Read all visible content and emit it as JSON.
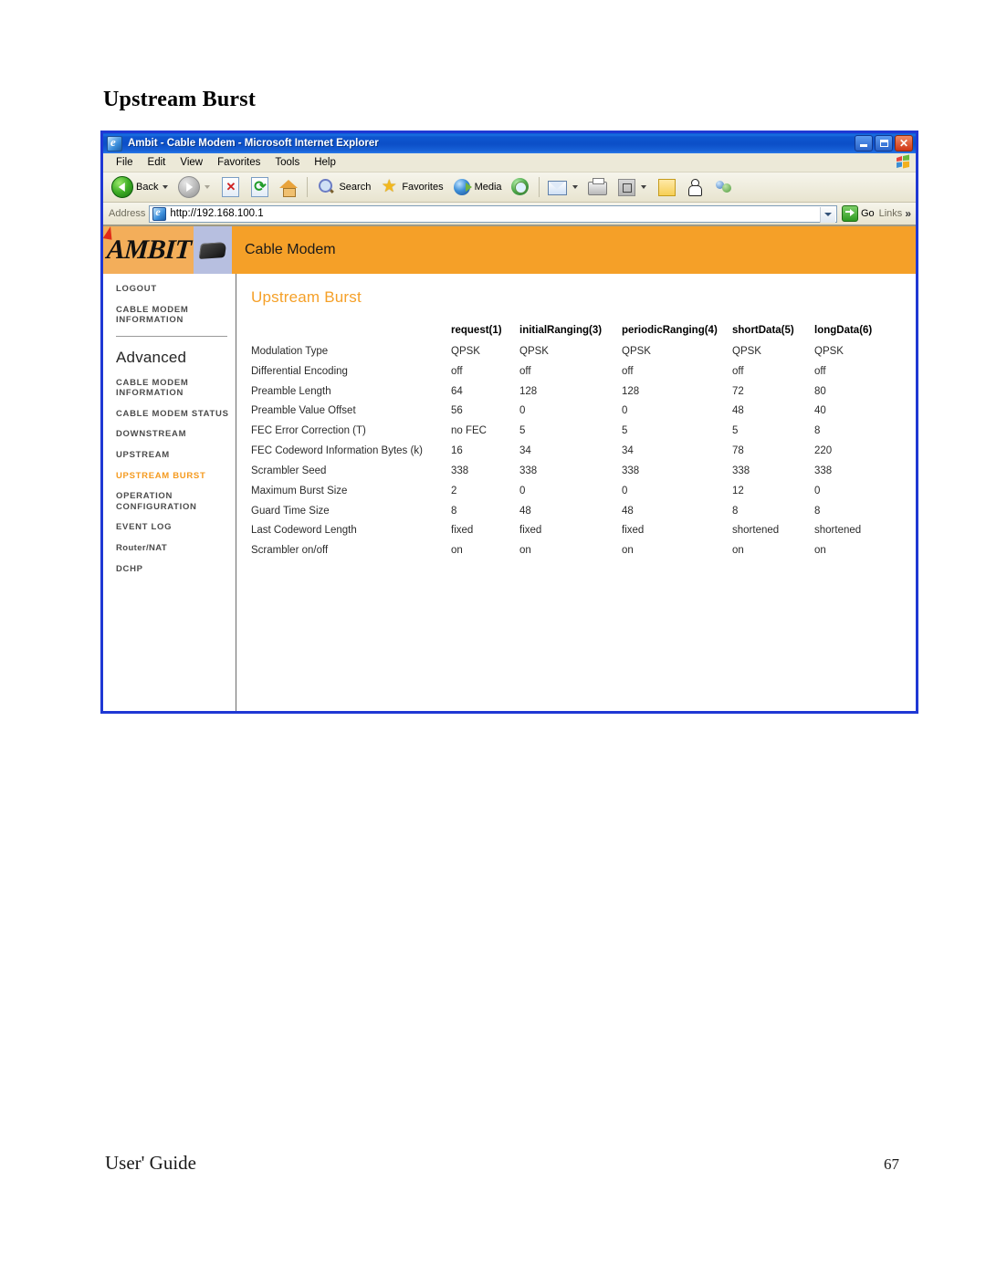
{
  "document": {
    "heading": "Upstream Burst",
    "footer_left": "User' Guide",
    "footer_page": "67"
  },
  "browser": {
    "window_title": "Ambit - Cable Modem - Microsoft Internet Explorer",
    "title_icon": "ie-document-icon",
    "window_buttons": {
      "minimize": "minimize-button",
      "maximize": "maximize-button",
      "close": "close-button"
    },
    "menu": [
      {
        "label": "File"
      },
      {
        "label": "Edit"
      },
      {
        "label": "View"
      },
      {
        "label": "Favorites"
      },
      {
        "label": "Tools"
      },
      {
        "label": "Help"
      }
    ],
    "toolbar": [
      {
        "label": "Back",
        "icon": "back-arrow-icon",
        "has_dropdown": true
      },
      {
        "label": "",
        "icon": "forward-arrow-icon",
        "has_dropdown": true
      },
      {
        "label": "",
        "icon": "stop-icon"
      },
      {
        "label": "",
        "icon": "refresh-icon"
      },
      {
        "label": "",
        "icon": "home-icon"
      },
      {
        "label": "Search",
        "icon": "search-icon"
      },
      {
        "label": "Favorites",
        "icon": "star-icon"
      },
      {
        "label": "Media",
        "icon": "media-icon"
      },
      {
        "label": "",
        "icon": "history-icon"
      },
      {
        "label": "",
        "icon": "mail-icon",
        "has_dropdown": true
      },
      {
        "label": "",
        "icon": "print-icon"
      },
      {
        "label": "",
        "icon": "edit-icon",
        "has_dropdown": true
      },
      {
        "label": "",
        "icon": "notes-icon"
      },
      {
        "label": "",
        "icon": "person-icon"
      },
      {
        "label": "",
        "icon": "messenger-icon"
      }
    ],
    "address": {
      "label": "Address",
      "url": "http://192.168.100.1",
      "go_label": "Go",
      "links_label": "Links"
    }
  },
  "app": {
    "brand": "AMBIT",
    "brand_icon": "cable-modem-device-icon",
    "header_title": "Cable Modem",
    "accent_color": "#F5A028"
  },
  "sidebar": {
    "top_items": [
      {
        "label": "LOGOUT",
        "active": false
      },
      {
        "label": "CABLE MODEM INFORMATION",
        "active": false
      }
    ],
    "section_heading": "Advanced",
    "items": [
      {
        "label": "CABLE MODEM INFORMATION",
        "active": false
      },
      {
        "label": "CABLE MODEM STATUS",
        "active": false
      },
      {
        "label": "DOWNSTREAM",
        "active": false
      },
      {
        "label": "UPSTREAM",
        "active": false
      },
      {
        "label": "UPSTREAM BURST",
        "active": true
      },
      {
        "label": "OPERATION CONFIGURATION",
        "active": false
      },
      {
        "label": "EVENT LOG",
        "active": false
      },
      {
        "label": "Router/NAT",
        "active": false
      },
      {
        "label": "DCHP",
        "active": false
      }
    ]
  },
  "main": {
    "page_title": "Upstream Burst",
    "table": {
      "columns": [
        "request(1)",
        "initialRanging(3)",
        "periodicRanging(4)",
        "shortData(5)",
        "longData(6)"
      ],
      "rows": [
        {
          "label": "Modulation Type",
          "values": [
            "QPSK",
            "QPSK",
            "QPSK",
            "QPSK",
            "QPSK"
          ]
        },
        {
          "label": "Differential Encoding",
          "values": [
            "off",
            "off",
            "off",
            "off",
            "off"
          ]
        },
        {
          "label": "Preamble Length",
          "values": [
            "64",
            "128",
            "128",
            "72",
            "80"
          ]
        },
        {
          "label": "Preamble Value Offset",
          "values": [
            "56",
            "0",
            "0",
            "48",
            "40"
          ]
        },
        {
          "label": "FEC Error Correction (T)",
          "values": [
            "no FEC",
            "5",
            "5",
            "5",
            "8"
          ]
        },
        {
          "label": "FEC Codeword Information Bytes (k)",
          "values": [
            "16",
            "34",
            "34",
            "78",
            "220"
          ]
        },
        {
          "label": "Scrambler Seed",
          "values": [
            "338",
            "338",
            "338",
            "338",
            "338"
          ]
        },
        {
          "label": "Maximum Burst Size",
          "values": [
            "2",
            "0",
            "0",
            "12",
            "0"
          ]
        },
        {
          "label": "Guard Time Size",
          "values": [
            "8",
            "48",
            "48",
            "8",
            "8"
          ]
        },
        {
          "label": "Last Codeword Length",
          "values": [
            "fixed",
            "fixed",
            "fixed",
            "shortened",
            "shortened"
          ]
        },
        {
          "label": "Scrambler on/off",
          "values": [
            "on",
            "on",
            "on",
            "on",
            "on"
          ]
        }
      ]
    }
  }
}
